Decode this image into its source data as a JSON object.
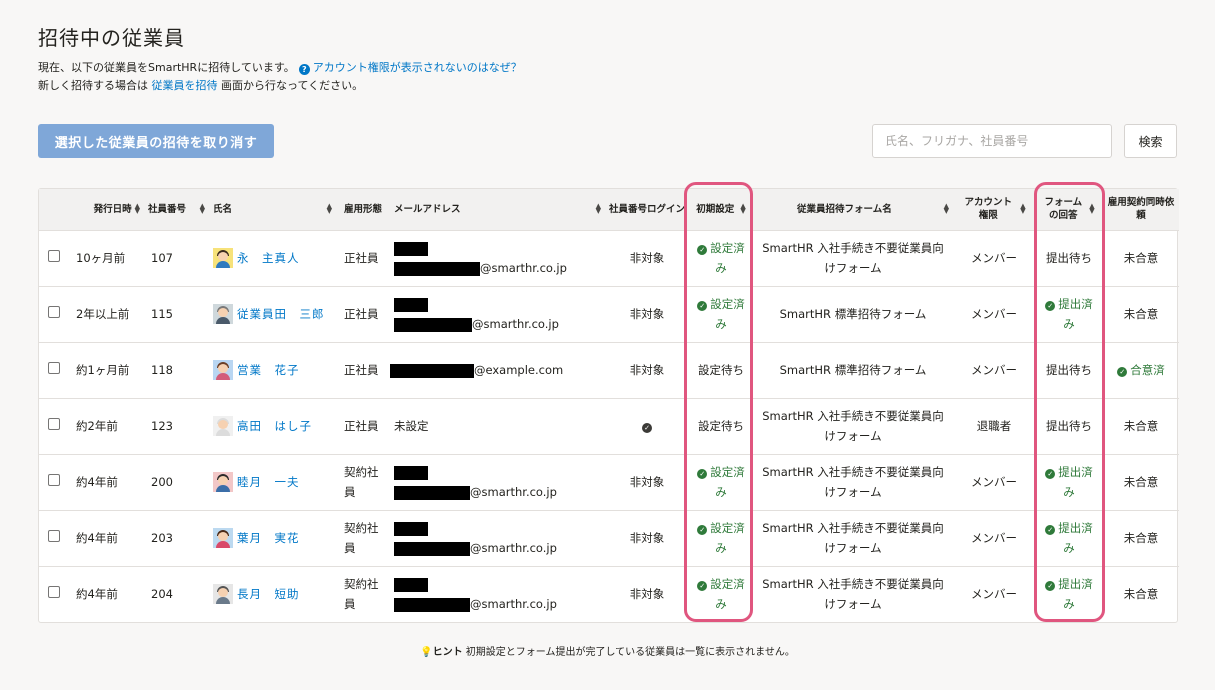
{
  "page": {
    "title": "招待中の従業員",
    "desc_line1_text": "現在、以下の従業員をSmartHRに招待しています。",
    "desc_line1_link": "アカウント権限が表示されないのはなぜ？",
    "desc_line2_pre": "新しく招待する場合は",
    "desc_line2_link": "従業員を招待",
    "desc_line2_post": "画面から行なってください。"
  },
  "toolbar": {
    "cancel_label": "選択した従業員の招待を取り消す",
    "search_placeholder": "氏名、フリガナ、社員番号",
    "search_label": "検索"
  },
  "table": {
    "headers": {
      "issued": "発行日時",
      "emp_no": "社員番号",
      "name": "氏名",
      "employment": "雇用形態",
      "email": "メールアドレス",
      "login": "社員番号ログイン",
      "init": "初期設定",
      "form_name": "従業員招待フォーム名",
      "account": "アカウント権限",
      "form_answer": "フォームの回答",
      "contract": "雇用契約同時依頼"
    },
    "rows": [
      {
        "issued": "10ヶ月前",
        "emp_no": "107",
        "name": "永　主真人",
        "employment": "正社員",
        "email_domain": "@smarthr.co.jp",
        "login": "非対象",
        "init": "設定済み",
        "form_name": "SmartHR 入社手続き不要従業員向けフォーム",
        "account": "メンバー",
        "form_answer": "提出待ち",
        "contract": "未合意"
      },
      {
        "issued": "2年以上前",
        "emp_no": "115",
        "name": "従業員田　三郎",
        "employment": "正社員",
        "email_domain": "@smarthr.co.jp",
        "login": "非対象",
        "init": "設定済み",
        "form_name": "SmartHR 標準招待フォーム",
        "account": "メンバー",
        "form_answer": "提出済み",
        "contract": "未合意"
      },
      {
        "issued": "約1ヶ月前",
        "emp_no": "118",
        "name": "営業　花子",
        "employment": "正社員",
        "email_domain": "@example.com",
        "login": "非対象",
        "init": "設定待ち",
        "form_name": "SmartHR 標準招待フォーム",
        "account": "メンバー",
        "form_answer": "提出待ち",
        "contract": "合意済"
      },
      {
        "issued": "約2年前",
        "emp_no": "123",
        "name": "高田　はし子",
        "employment": "正社員",
        "email_text": "未設定",
        "login": "",
        "init": "設定待ち",
        "form_name": "SmartHR 入社手続き不要従業員向けフォーム",
        "account": "退職者",
        "form_answer": "提出待ち",
        "contract": "未合意"
      },
      {
        "issued": "約4年前",
        "emp_no": "200",
        "name": "睦月　一夫",
        "employment": "契約社員",
        "email_domain": "@smarthr.co.jp",
        "login": "非対象",
        "init": "設定済み",
        "form_name": "SmartHR 入社手続き不要従業員向けフォーム",
        "account": "メンバー",
        "form_answer": "提出済み",
        "contract": "未合意"
      },
      {
        "issued": "約4年前",
        "emp_no": "203",
        "name": "葉月　実花",
        "employment": "契約社員",
        "email_domain": "@smarthr.co.jp",
        "login": "非対象",
        "init": "設定済み",
        "form_name": "SmartHR 入社手続き不要従業員向けフォーム",
        "account": "メンバー",
        "form_answer": "提出済み",
        "contract": "未合意"
      },
      {
        "issued": "約4年前",
        "emp_no": "204",
        "name": "長月　短助",
        "employment": "契約社員",
        "email_domain": "@smarthr.co.jp",
        "login": "非対象",
        "init": "設定済み",
        "form_name": "SmartHR 入社手続き不要従業員向けフォーム",
        "account": "メンバー",
        "form_answer": "提出済み",
        "contract": "未合意"
      }
    ]
  },
  "hint": {
    "label": "ヒント",
    "text": "初期設定とフォーム提出が完了している従業員は一覧に表示されません。"
  },
  "colors": {
    "link": "#0077c7",
    "success": "#2f7a3a",
    "highlight": "#e0567f",
    "primary_disabled": "#7fa7d8"
  }
}
